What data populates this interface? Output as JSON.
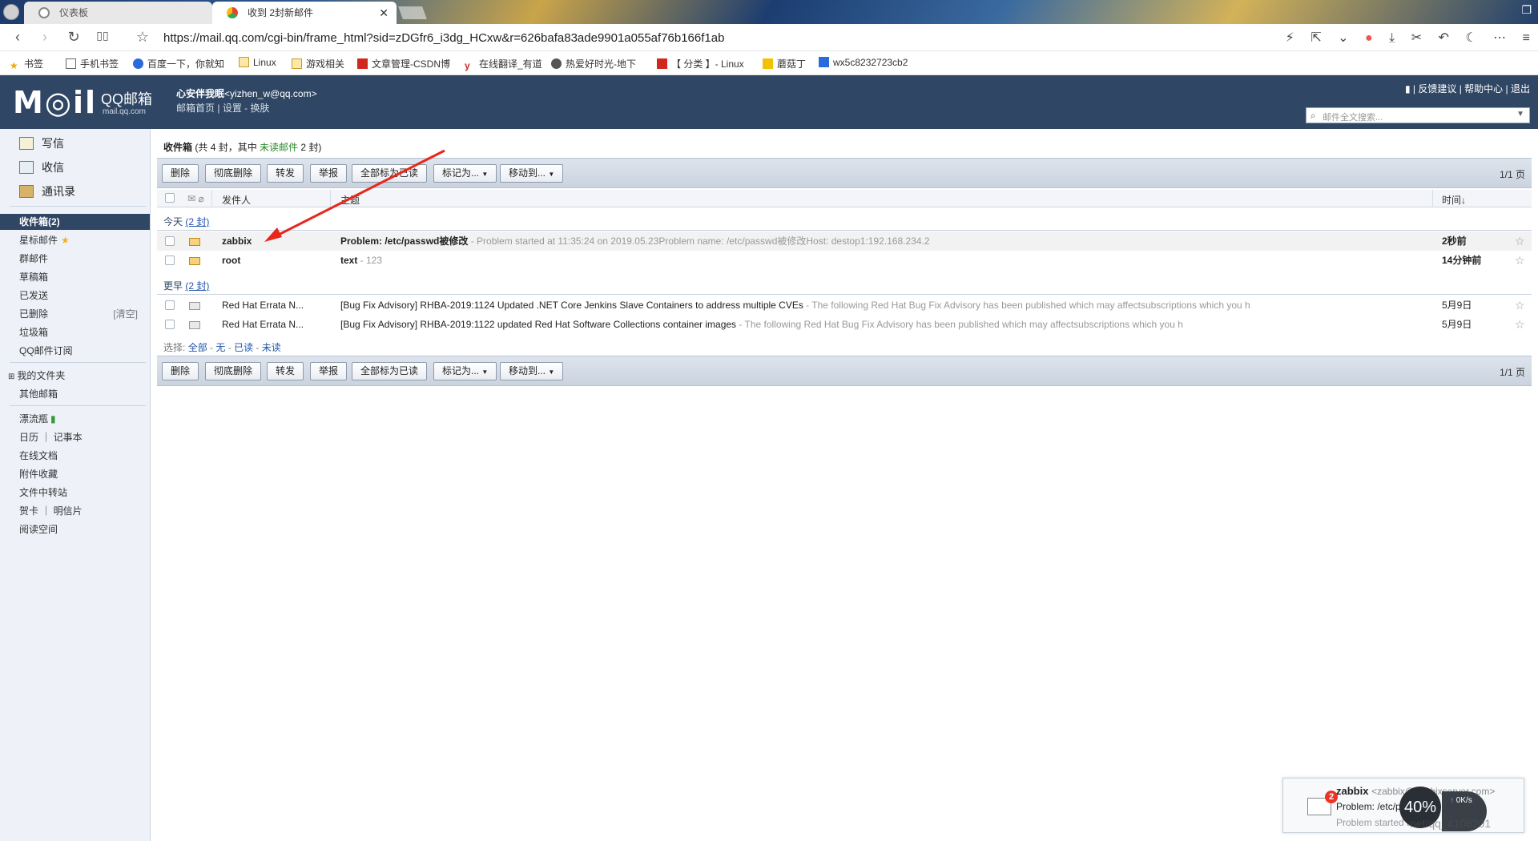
{
  "browser": {
    "tabs": [
      {
        "label": "仪表板",
        "active": false
      },
      {
        "label": "收到 2封新邮件",
        "active": true
      }
    ],
    "url": "https://mail.qq.com/cgi-bin/frame_html?sid=zDGfr6_i3dg_HCxw&r=626bafa83ade9901a055af76b166f1ab",
    "bookmarks": [
      "书签",
      "手机书签",
      "百度一下，你就知",
      "Linux",
      "游戏相关",
      "文章管理-CSDN博",
      "在线翻译_有道",
      "热爱好时光-地下",
      "【 分类 】- Linux",
      "蘑菇丁",
      "wx5c8232723cb2"
    ]
  },
  "header": {
    "logo": "M◎il",
    "logo_sub": "QQ邮箱",
    "logo_url": "mail.qq.com",
    "user_nick": "心安伴我眠",
    "user_email": "<yizhen_w@qq.com>",
    "links": [
      "邮箱首页",
      "设置",
      "换肤"
    ],
    "top_links": [
      "反馈建议",
      "帮助中心",
      "退出"
    ],
    "search_placeholder": "邮件全文搜索..."
  },
  "sidebar": {
    "main": [
      {
        "label": "写信"
      },
      {
        "label": "收信"
      },
      {
        "label": "通讯录"
      }
    ],
    "active": "收件箱(2)",
    "folders": [
      "星标邮件",
      "群邮件",
      "草稿箱",
      "已发送",
      "已删除",
      "垃圾箱",
      "QQ邮件订阅"
    ],
    "clear_label": "[清空]",
    "my_folders": "我的文件夹",
    "other_mailbox": "其他邮箱",
    "apps": [
      "漂流瓶",
      "日历 ｜ 记事本",
      "在线文档",
      "附件收藏",
      "文件中转站",
      "贺卡 ｜ 明信片",
      "阅读空间"
    ]
  },
  "inbox": {
    "title": "收件箱",
    "summary_pre": "(共 4 封，其中",
    "summary_unread": "未读邮件",
    "summary_post": "2 封)",
    "toolbar": [
      "删除",
      "彻底删除",
      "转发",
      "举报",
      "全部标为已读",
      "标记为...",
      "移动到..."
    ],
    "pager": "1/1 页",
    "columns": {
      "from": "发件人",
      "subject": "主题",
      "time": "时间↓"
    },
    "groups": [
      {
        "label": "今天",
        "count": "(2 封)",
        "rows": [
          {
            "from": "zabbix",
            "subject": "Problem: /etc/passwd被修改",
            "preview": " - Problem started at 11:35:24 on 2019.05.23Problem name: /etc/passwd被修改Host: destop1:192.168.234.2",
            "time": "2秒前",
            "unread": true
          },
          {
            "from": "root",
            "subject": "text",
            "preview": " - 123",
            "time": "14分钟前",
            "unread": true
          }
        ]
      },
      {
        "label": "更早",
        "count": "(2 封)",
        "rows": [
          {
            "from": "Red Hat Errata N...",
            "subject": "[Bug Fix Advisory] RHBA-2019:1124 Updated .NET Core Jenkins Slave Containers to address multiple CVEs",
            "preview": " - The following Red Hat Bug Fix Advisory has been published which may affectsubscriptions which you h",
            "time": "5月9日",
            "unread": false
          },
          {
            "from": "Red Hat Errata N...",
            "subject": "[Bug Fix Advisory] RHBA-2019:1122 updated Red Hat Software Collections container images",
            "preview": " - The following Red Hat Bug Fix Advisory has been published which may affectsubscriptions which you h",
            "time": "5月9日",
            "unread": false
          }
        ]
      }
    ],
    "select_label": "选择:",
    "select_opts": [
      "全部",
      "无",
      "已读",
      "未读"
    ]
  },
  "notification": {
    "badge": "2",
    "from": "zabbix",
    "from_email": "<zabbix@zabbixserver.com>",
    "subject": "Problem: /etc/passwd",
    "preview": "Problem started at"
  },
  "overlay": {
    "speed_percent": "40%",
    "speed_rate": "0K/s",
    "watermark": "net/qq_4108201"
  }
}
